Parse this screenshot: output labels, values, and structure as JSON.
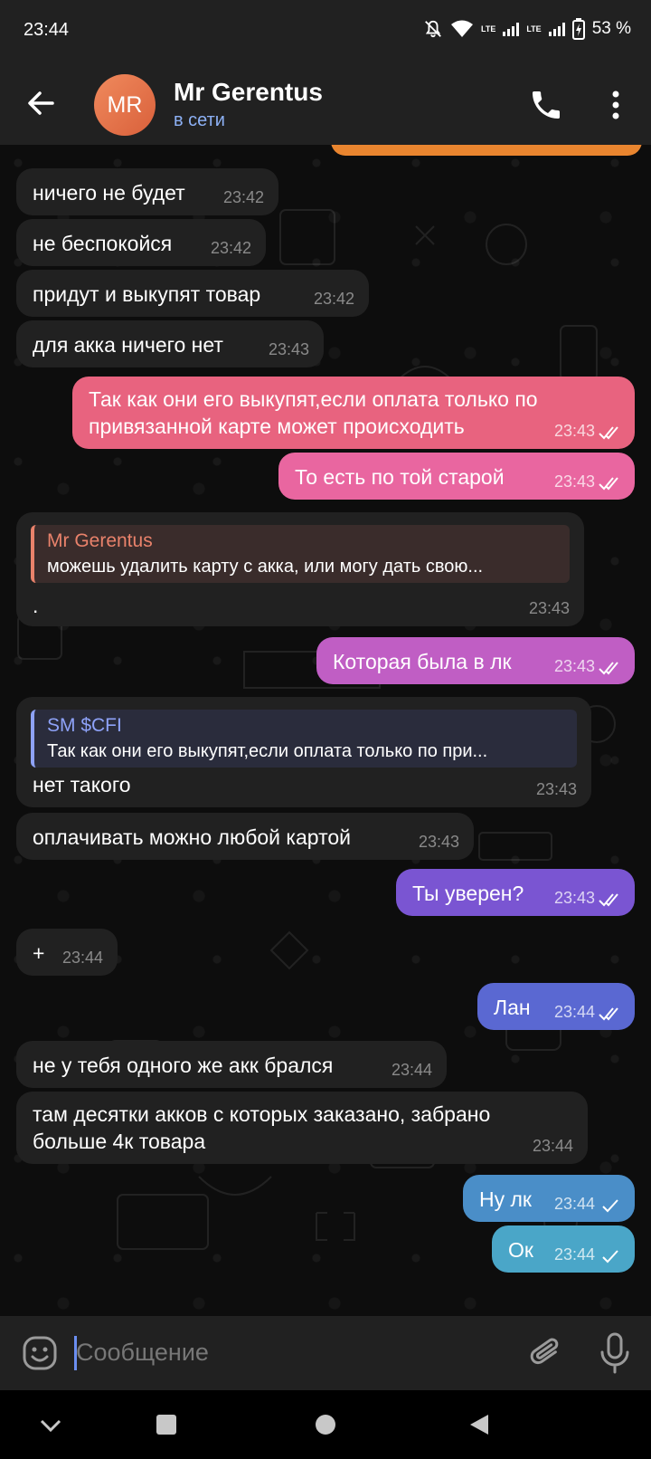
{
  "status_bar": {
    "time": "23:44",
    "lte_1": "LTE",
    "lte_2": "LTE",
    "battery": "53 %"
  },
  "header": {
    "avatar_initials": "MR",
    "name": "Mr Gerentus",
    "status": "в сети"
  },
  "messages": [
    {
      "text": "ничего не будет",
      "time": "23:42"
    },
    {
      "text": "не беспокойся",
      "time": "23:42"
    },
    {
      "text": "придут и выкупят товар",
      "time": "23:42"
    },
    {
      "text": "для акка ничего нет",
      "time": "23:43"
    },
    {
      "line1": "Так как они его выкупят,если оплата только по",
      "line2": "привязанной карте может происходить",
      "time": "23:43"
    },
    {
      "text": "То есть по той старой",
      "time": "23:43"
    },
    {
      "reply_name": "Mr Gerentus",
      "reply_text": "можешь удалить карту с акка, или могу дать свою...",
      "text": ".",
      "time": "23:43"
    },
    {
      "text": "Которая была в лк",
      "time": "23:43"
    },
    {
      "reply_name": "SM $CFI",
      "reply_text": "Так как они его выкупят,если оплата только по при...",
      "text": "нет такого",
      "time": "23:43"
    },
    {
      "text": "оплачивать можно любой картой",
      "time": "23:43"
    },
    {
      "text": "Ты уверен?",
      "time": "23:43"
    },
    {
      "text": "+",
      "time": "23:44"
    },
    {
      "text": "Лан",
      "time": "23:44"
    },
    {
      "text": "не у тебя одного же акк брался",
      "time": "23:44"
    },
    {
      "line1": "там десятки акков с которых заказано, забрано",
      "line2": "больше 4к товара",
      "time": "23:44"
    },
    {
      "text": "Ну лк",
      "time": "23:44"
    },
    {
      "text": "Ок",
      "time": "23:44"
    }
  ],
  "input": {
    "placeholder": "Сообщение"
  },
  "colors": {
    "incoming_bubble": "#212121",
    "reply_accent_orange": "#e9826b",
    "reply_accent_blue": "#8ea2f8",
    "outgoing_gradient_top": "#e8628a",
    "outgoing_gradient_bottom": "#4ba7c9"
  }
}
